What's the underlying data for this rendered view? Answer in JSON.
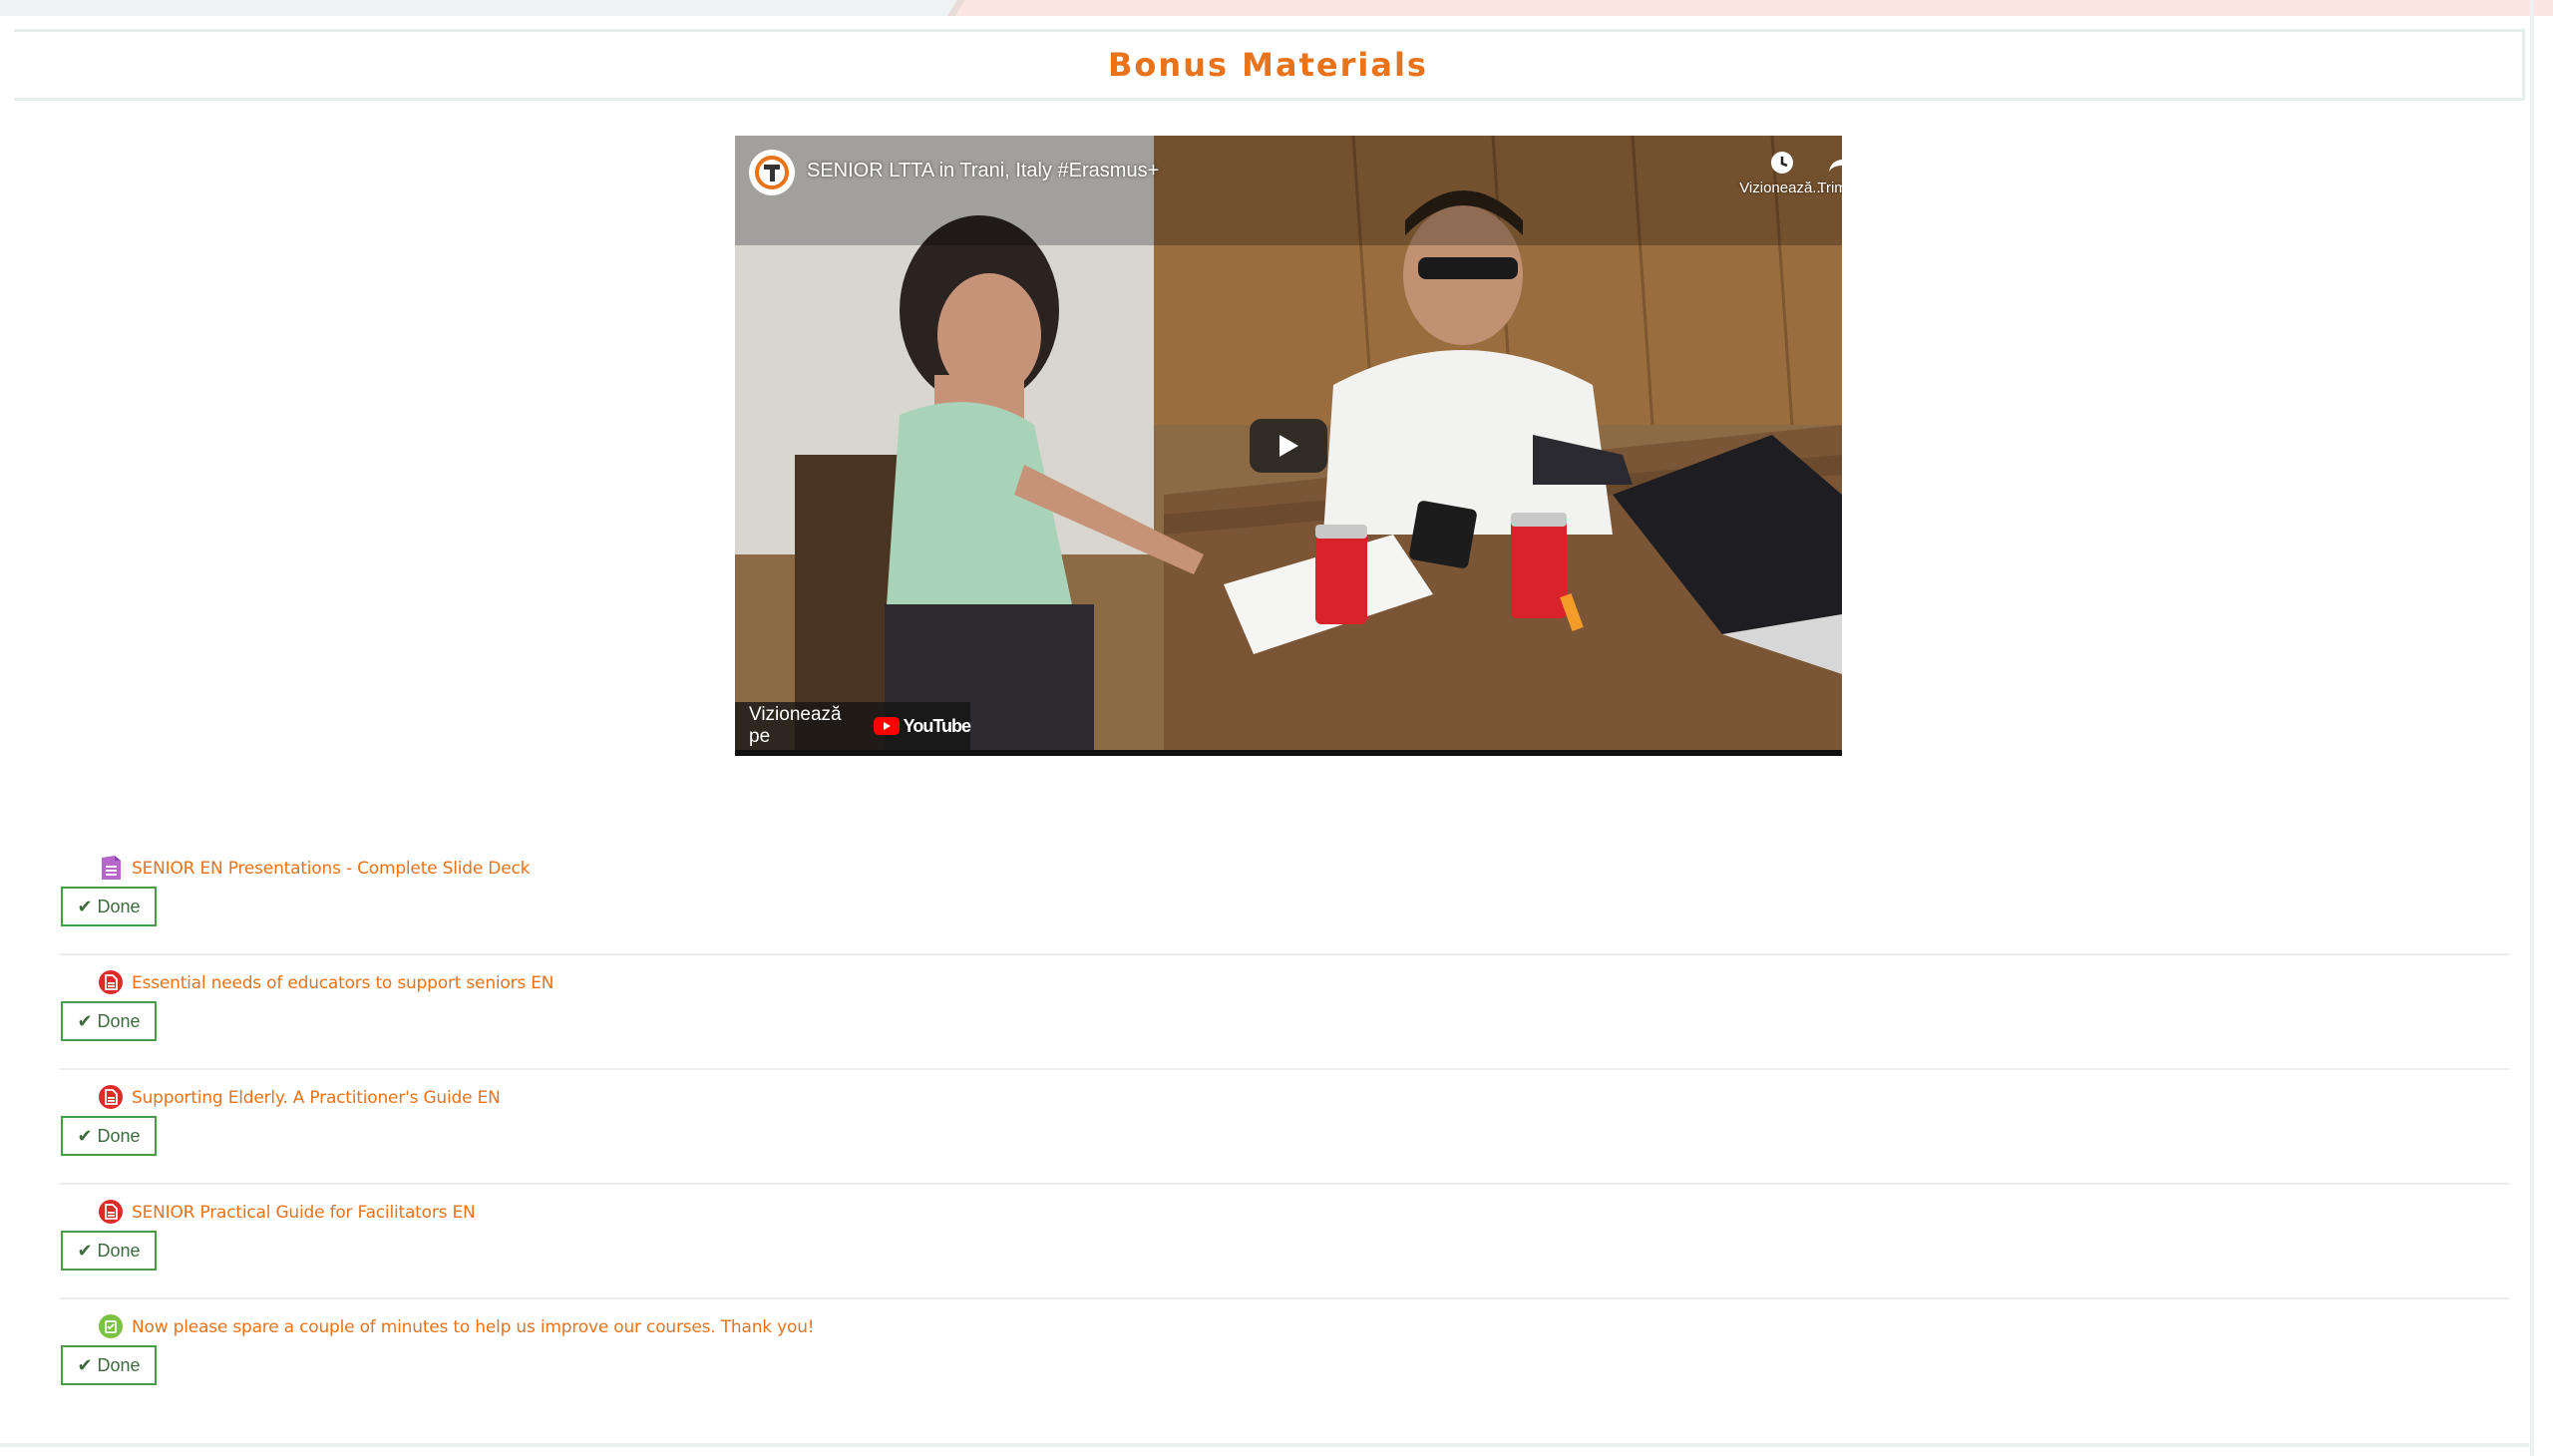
{
  "page": {
    "section_title": "Bonus Materials"
  },
  "video": {
    "title": "SENIOR LTTA in Trani, Italy #Erasmus+",
    "watch_later_label": "Vizionează...",
    "share_label": "Trimite",
    "watch_on_label": "Vizionează pe",
    "youtube_label": "YouTube"
  },
  "activities": [
    {
      "label": "SENIOR EN Presentations - Complete Slide Deck",
      "icon": "presentation-icon",
      "done_label": "Done"
    },
    {
      "label": "Essential needs of educators to support seniors EN",
      "icon": "pdf-icon",
      "done_label": "Done"
    },
    {
      "label": "Supporting Elderly. A Practitioner's Guide EN",
      "icon": "pdf-icon",
      "done_label": "Done"
    },
    {
      "label": "SENIOR Practical Guide for Facilitators EN",
      "icon": "pdf-icon",
      "done_label": "Done"
    },
    {
      "label": "Now please spare a couple of minutes to help us improve our courses. Thank you!",
      "icon": "feedback-icon",
      "done_label": "Done"
    }
  ],
  "colors": {
    "accent": "#e8731b",
    "done_border": "#4a9a4a",
    "pdf_red": "#e02b2b",
    "feedback_green": "#7cc242"
  }
}
